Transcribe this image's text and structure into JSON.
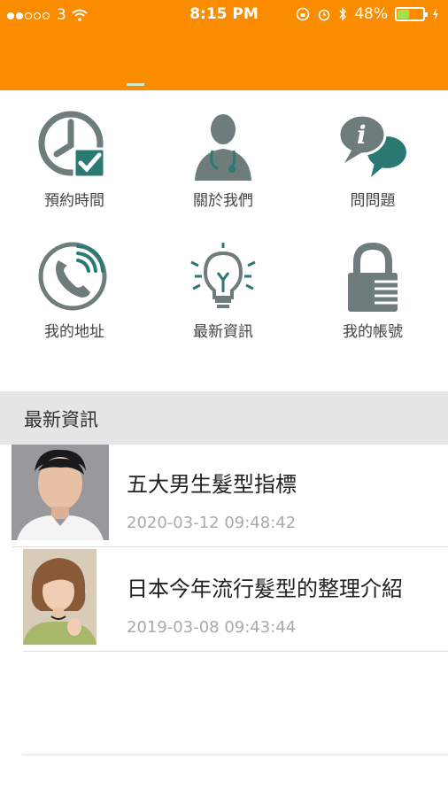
{
  "status_bar": {
    "carrier": "3",
    "time": "8:15 PM",
    "battery": "48%",
    "battery_level": 0.48
  },
  "menu": [
    {
      "label": "預約時間",
      "icon": "clock-check-icon"
    },
    {
      "label": "關於我們",
      "icon": "doctor-icon"
    },
    {
      "label": "問問題",
      "icon": "chat-info-icon"
    },
    {
      "label": "我的地址",
      "icon": "phone-icon"
    },
    {
      "label": "最新資訊",
      "icon": "lightbulb-icon"
    },
    {
      "label": "我的帳號",
      "icon": "lock-icon"
    }
  ],
  "news_section": {
    "title": "最新資訊",
    "items": [
      {
        "title": "五大男生髮型指標",
        "date": "2020-03-12 09:48:42"
      },
      {
        "title": "日本今年流行髮型的整理介紹",
        "date": "2019-03-08 09:43:44"
      }
    ]
  },
  "colors": {
    "accent": "#fb8c00",
    "icon": "#6e7c7c",
    "icon_teal": "#2a7a73"
  }
}
